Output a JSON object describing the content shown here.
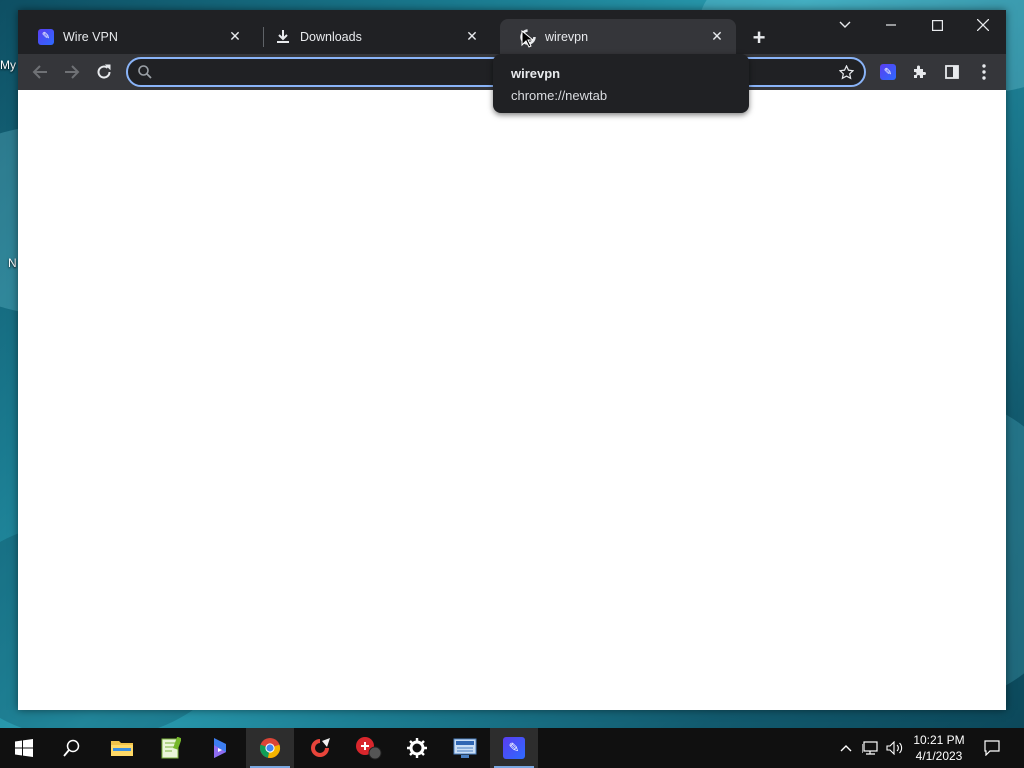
{
  "desktop": {
    "partial_labels": [
      "My",
      "N"
    ]
  },
  "browser": {
    "tabs": [
      {
        "title": "Wire VPN",
        "icon": "wire-vpn-icon",
        "active": false
      },
      {
        "title": "Downloads",
        "icon": "download-icon",
        "active": false
      },
      {
        "title": "wirevpn",
        "icon": "puzzle-loading-icon",
        "active": true
      }
    ],
    "new_tab_label": "+",
    "omnibox": {
      "value": "",
      "placeholder": ""
    },
    "tooltip": {
      "title": "wirevpn",
      "url": "chrome://newtab"
    }
  },
  "taskbar": {
    "apps": [
      "start-icon",
      "search-icon",
      "file-explorer-icon",
      "notepad-plus-icon",
      "copilot-icon",
      "chrome-icon",
      "ccleaner-icon",
      "security-icon",
      "settings-icon",
      "network-app-icon",
      "wire-vpn-icon"
    ],
    "clock": {
      "time": "10:21 PM",
      "date": "4/1/2023"
    }
  }
}
